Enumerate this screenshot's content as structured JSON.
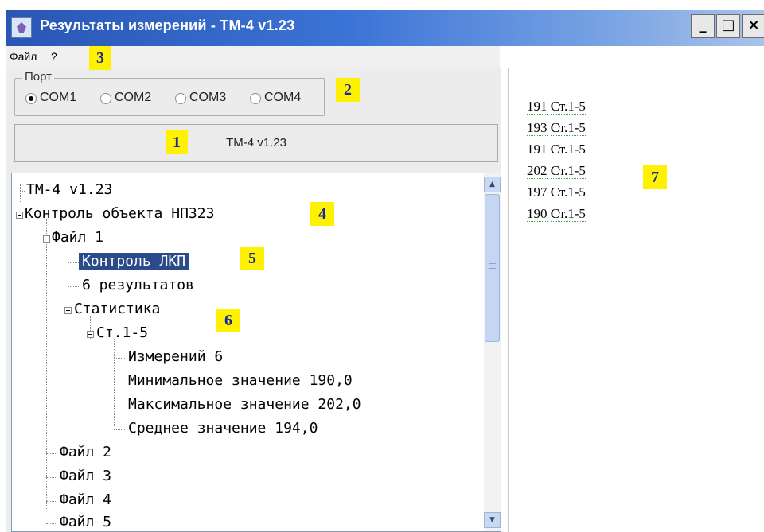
{
  "window": {
    "title": "Результаты измерений - ТМ-4 v1.23",
    "minimize": "_",
    "maximize": "□",
    "close": "×"
  },
  "menu": {
    "file": "Файл",
    "help": "?"
  },
  "port": {
    "legend": "Порт",
    "options": [
      "COM1",
      "COM2",
      "COM3",
      "COM4"
    ],
    "selected": "COM1"
  },
  "status": {
    "text": "ТМ-4 v1.23"
  },
  "tree": {
    "nodes": [
      "ТМ-4 v1.23",
      "Контроль объекта НПЗ23",
      "Файл 1",
      "Контроль ЛКП",
      "6 результатов",
      "Статистика",
      "Ст.1-5",
      "Измерений 6",
      "Минимальное значение 190,0",
      "Максимальное значение 202,0",
      "Среднее значение 194,0",
      "Файл 2",
      "Файл 3",
      "Файл 4",
      "Файл 5"
    ],
    "selected": "Контроль ЛКП"
  },
  "results": [
    {
      "value": "191",
      "label": "Ст.1-5"
    },
    {
      "value": "193",
      "label": "Ст.1-5"
    },
    {
      "value": "191",
      "label": "Ст.1-5"
    },
    {
      "value": "202",
      "label": "Ст.1-5"
    },
    {
      "value": "197",
      "label": "Ст.1-5"
    },
    {
      "value": "190",
      "label": "Ст.1-5"
    }
  ],
  "callouts": [
    "1",
    "2",
    "3",
    "4",
    "5",
    "6",
    "7"
  ],
  "colors": {
    "titlebar": "#2a56b4",
    "selection": "#2a4a8a",
    "callout_bg": "#fff200",
    "callout_text": "#1b2a9a"
  }
}
